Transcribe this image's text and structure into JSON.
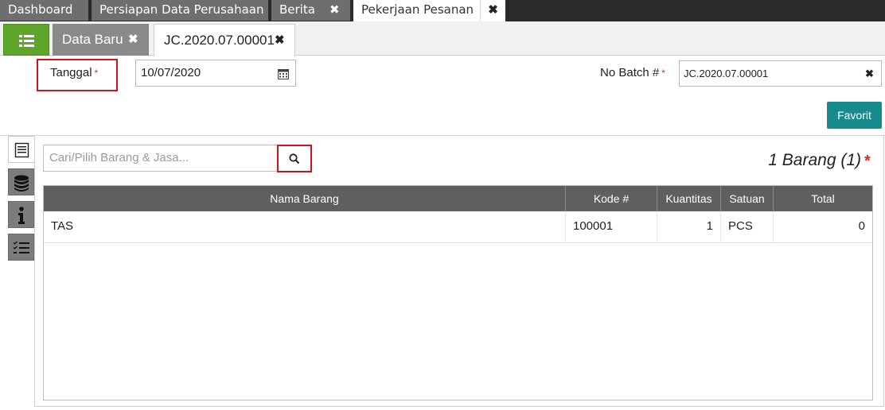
{
  "top_tabs": [
    {
      "label": "Dashboard"
    },
    {
      "label": "Persiapan Data Perusahaan"
    },
    {
      "label": "Berita"
    },
    {
      "label": "Pekerjaan Pesanan"
    }
  ],
  "sub_tabs": [
    {
      "label": "Data Baru"
    },
    {
      "label": "JC.2020.07.00001"
    }
  ],
  "icons": {
    "close": "✖",
    "required": "*"
  },
  "form": {
    "tanggal_label": "Tanggal",
    "tanggal_value": "10/07/2020",
    "batch_label": "No Batch #",
    "batch_value": "JC.2020.07.00001",
    "favorit_label": "Favorit"
  },
  "items": {
    "search_placeholder": "Cari/Pilih Barang & Jasa...",
    "count_label": "1 Barang (1)",
    "columns": [
      "Nama Barang",
      "Kode #",
      "Kuantitas",
      "Satuan",
      "Total"
    ],
    "rows": [
      {
        "nama": "TAS",
        "kode": "100001",
        "kuantitas": "1",
        "satuan": "PCS",
        "total": "0"
      }
    ]
  },
  "colors": {
    "accent_green": "#5ea62a",
    "favorit_teal": "#178b8b",
    "highlight_red": "#d0121b"
  }
}
